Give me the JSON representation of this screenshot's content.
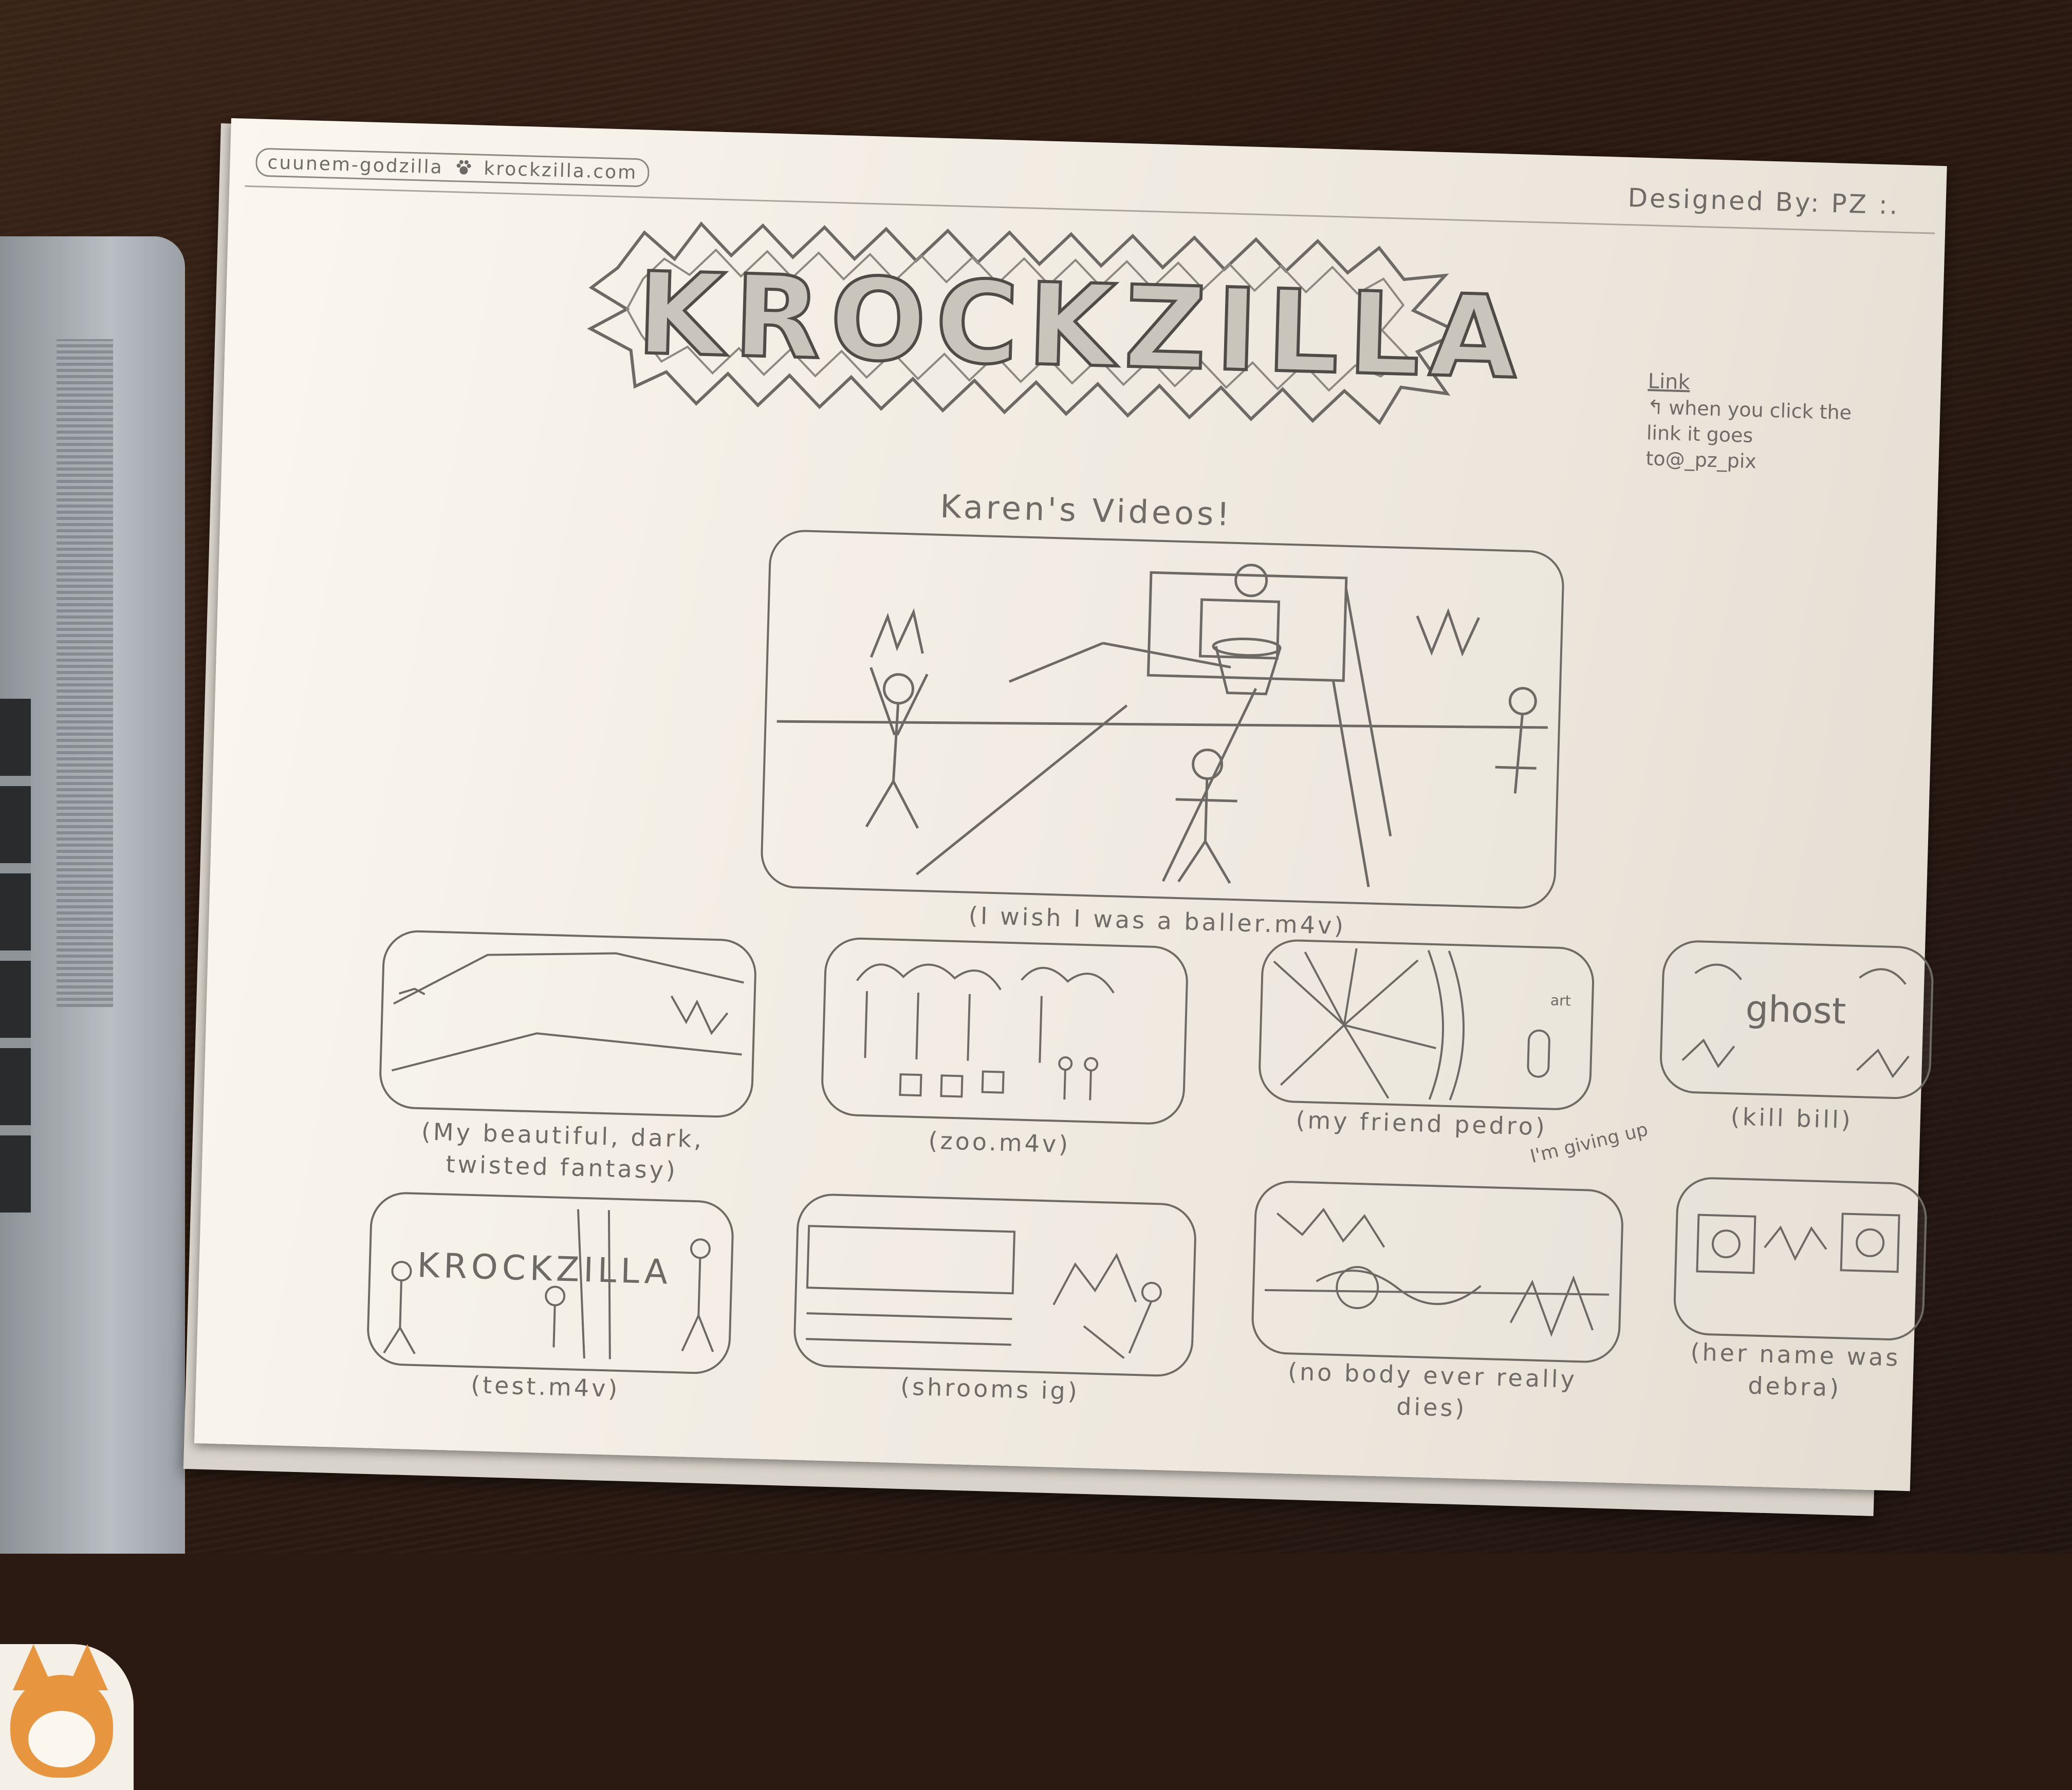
{
  "browser": {
    "url_left": "cuunem-godzilla",
    "url_right": "krockzilla.com",
    "designed_by": "Designed By: PZ :."
  },
  "header": {
    "logo": "KROCKZILLA"
  },
  "side_note": {
    "link_label": "Link",
    "text": "when you click the link it goes to@_pz_pix"
  },
  "main": {
    "title": "Karen's Videos!",
    "featured": {
      "caption": "(I wish I was a baller.m4v)"
    }
  },
  "grid": {
    "row1": [
      {
        "caption": "(My beautiful, dark, twisted fantasy)",
        "thumb_text": ""
      },
      {
        "caption": "(zoo.m4v)",
        "thumb_text": ""
      },
      {
        "caption": "(my friend pedro)",
        "thumb_text": "art"
      },
      {
        "caption": "(kill bill)",
        "thumb_text": "ghost"
      }
    ],
    "row2": [
      {
        "caption": "(test.m4v)",
        "thumb_text": "KROCKZILLA"
      },
      {
        "caption": "(shrooms ig)",
        "thumb_text": ""
      },
      {
        "caption": "(no body ever really dies)",
        "thumb_text": ""
      },
      {
        "caption": "(her name was debra)",
        "thumb_text": ""
      }
    ],
    "note": "I'm giving up"
  },
  "colors": {
    "desk": "#2b1a11",
    "paper": "#f4efe6",
    "pencil": "#6d6a66"
  }
}
